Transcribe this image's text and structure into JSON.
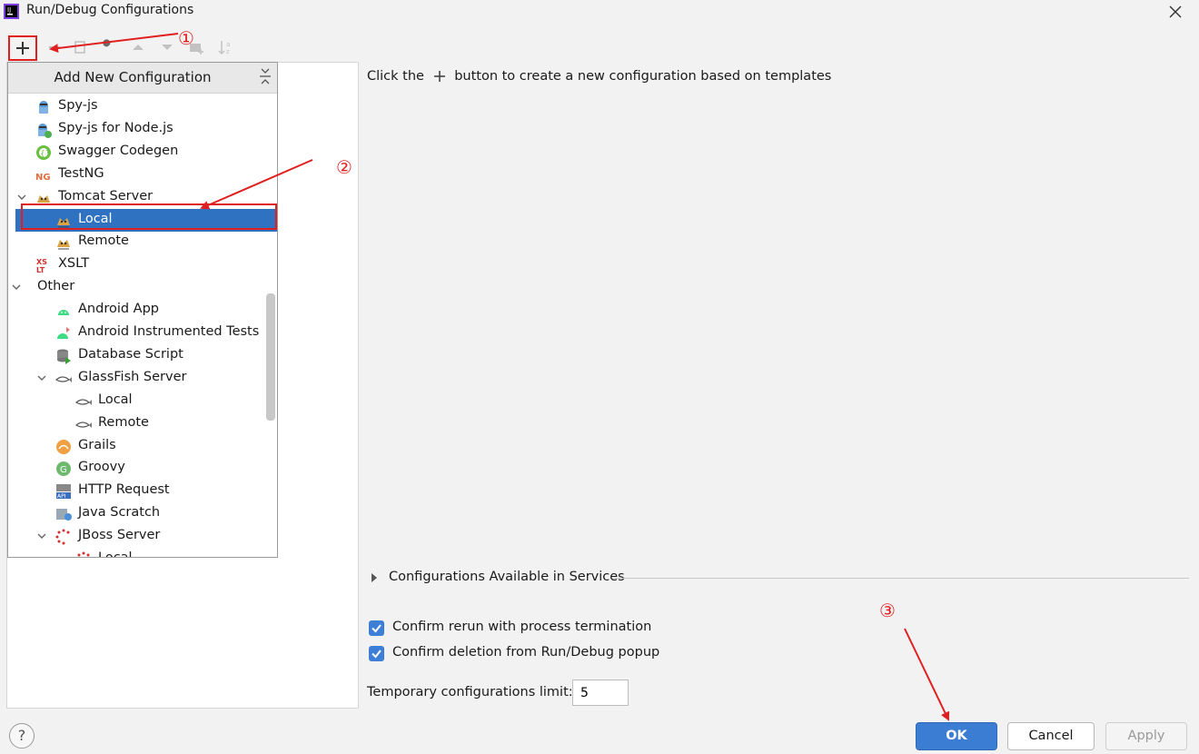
{
  "window": {
    "title": "Run/Debug Configurations"
  },
  "popup": {
    "title": "Add New Configuration",
    "items": [
      {
        "label": "Spy-js",
        "icon": "spy-js-icon",
        "level": 1,
        "expandable": false
      },
      {
        "label": "Spy-js for Node.js",
        "icon": "spy-js-node-icon",
        "level": 1,
        "expandable": false
      },
      {
        "label": "Swagger Codegen",
        "icon": "swagger-icon",
        "level": 1,
        "expandable": false
      },
      {
        "label": "TestNG",
        "icon": "testng-icon",
        "level": 1,
        "expandable": false
      },
      {
        "label": "Tomcat Server",
        "icon": "tomcat-icon",
        "level": 1,
        "expandable": true
      },
      {
        "label": "Local",
        "icon": "tomcat-icon",
        "level": 2,
        "expandable": false,
        "selected": true
      },
      {
        "label": "Remote",
        "icon": "tomcat-icon",
        "level": 2,
        "expandable": false
      },
      {
        "label": "XSLT",
        "icon": "xslt-icon",
        "level": 1,
        "expandable": false
      },
      {
        "label": "Other",
        "icon": "",
        "level": 0,
        "expandable": true
      },
      {
        "label": "Android App",
        "icon": "android-icon",
        "level": 2,
        "expandable": false
      },
      {
        "label": "Android Instrumented Tests",
        "icon": "android-test-icon",
        "level": 2,
        "expandable": false
      },
      {
        "label": "Database Script",
        "icon": "database-icon",
        "level": 2,
        "expandable": false
      },
      {
        "label": "GlassFish Server",
        "icon": "glassfish-icon",
        "level": 2,
        "expandable": true
      },
      {
        "label": "Local",
        "icon": "glassfish-icon",
        "level": 3,
        "expandable": false
      },
      {
        "label": "Remote",
        "icon": "glassfish-icon",
        "level": 3,
        "expandable": false
      },
      {
        "label": "Grails",
        "icon": "grails-icon",
        "level": 2,
        "expandable": false
      },
      {
        "label": "Groovy",
        "icon": "groovy-icon",
        "level": 2,
        "expandable": false
      },
      {
        "label": "HTTP Request",
        "icon": "api-icon",
        "level": 2,
        "expandable": false
      },
      {
        "label": "Java Scratch",
        "icon": "java-scratch-icon",
        "level": 2,
        "expandable": false
      },
      {
        "label": "JBoss Server",
        "icon": "jboss-icon",
        "level": 2,
        "expandable": true
      },
      {
        "label": "Local",
        "icon": "jboss-icon",
        "level": 3,
        "expandable": false
      }
    ]
  },
  "right": {
    "hint_before": "Click the",
    "hint_after": "button to create a new configuration based on templates",
    "services_label": "Configurations Available in Services",
    "confirm_rerun": "Confirm rerun with process termination",
    "confirm_deletion": "Confirm deletion from Run/Debug popup",
    "limit_label": "Temporary configurations limit:",
    "limit_value": "5"
  },
  "buttons": {
    "ok": "OK",
    "cancel": "Cancel",
    "apply": "Apply",
    "help": "?"
  },
  "annotations": {
    "n1": "①",
    "n2": "②",
    "n3": "③"
  },
  "colors": {
    "accent": "#2f72c2",
    "annotation": "#e02020"
  }
}
